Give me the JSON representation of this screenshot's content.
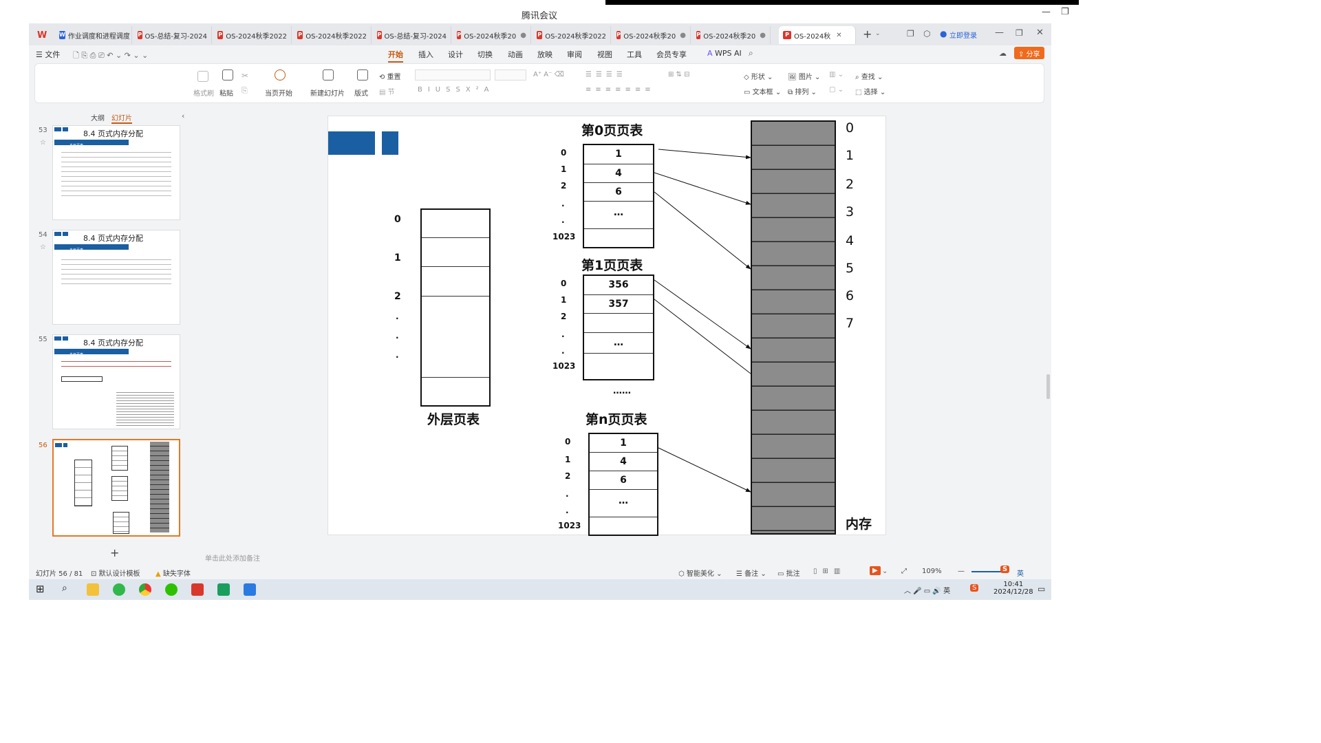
{
  "meeting": {
    "title": "腾讯会议"
  },
  "tabs": [
    {
      "label": "W",
      "type": "wps"
    },
    {
      "label": "作业调度和进程调度",
      "type": "doc"
    },
    {
      "label": "OS-总结-复习-2024",
      "type": "ppt"
    },
    {
      "label": "OS-2024秋季2022",
      "type": "ppt"
    },
    {
      "label": "OS-2024秋季2022",
      "type": "ppt"
    },
    {
      "label": "OS-总结-复习-2024",
      "type": "ppt"
    },
    {
      "label": "OS-2024秋季20",
      "type": "ppt"
    },
    {
      "label": "OS-2024秋季2022",
      "type": "ppt"
    },
    {
      "label": "OS-2024秋季20",
      "type": "ppt"
    },
    {
      "label": "OS-2024秋季20",
      "type": "ppt"
    },
    {
      "label": "OS-2024秋",
      "type": "ppt"
    }
  ],
  "account": {
    "login_label": "立即登录"
  },
  "menu": {
    "file": "文件",
    "items": [
      "开始",
      "插入",
      "设计",
      "切换",
      "动画",
      "放映",
      "审阅",
      "视图",
      "工具",
      "会员专享"
    ],
    "active": "开始",
    "wps_ai": "WPS AI",
    "share": "分享"
  },
  "ribbon": {
    "format_painter": "格式刷",
    "paste": "粘贴",
    "from_current": "当页开始",
    "new_slide": "新建幻灯片",
    "layout": "版式",
    "reset": "重置",
    "section": "节",
    "shape": "形状",
    "picture": "图片",
    "textbox": "文本框",
    "arrange": "排列",
    "find": "查找",
    "select": "选择"
  },
  "left_pane": {
    "tab_outline": "大纲",
    "tab_slides": "幻灯片",
    "thumbnails": [
      {
        "num": "53",
        "title": "8.4 页式内存分配",
        "sub": "多级页表"
      },
      {
        "num": "54",
        "title": "8.4 页式内存分配",
        "sub": "多级页表"
      },
      {
        "num": "55",
        "title": "8.4 页式内存分配",
        "sub": "多级页表"
      },
      {
        "num": "56",
        "title": "",
        "sub": ""
      }
    ],
    "add": "+"
  },
  "slide": {
    "outer_indices": [
      "0",
      "1",
      "2",
      ".",
      ".",
      "."
    ],
    "outer_label": "外层页表",
    "page_tables": [
      {
        "title": "第0页页表",
        "indices": [
          "0",
          "1",
          "2",
          ".",
          ".",
          "1023"
        ],
        "entries": [
          "1",
          "4",
          "6",
          "…",
          ""
        ]
      },
      {
        "title": "第1页页表",
        "indices": [
          "0",
          "1",
          "2",
          ".",
          ".",
          "1023"
        ],
        "entries": [
          "356",
          "357",
          "",
          "…",
          ""
        ]
      },
      {
        "title": "第n页页表",
        "indices": [
          "0",
          "1",
          "2",
          ".",
          ".",
          "1023"
        ],
        "entries": [
          "1",
          "4",
          "6",
          "…",
          ""
        ]
      }
    ],
    "dots_between": "……",
    "memory_indices": [
      "0",
      "1",
      "2",
      "3",
      "4",
      "5",
      "6",
      "7"
    ],
    "memory_label": "内存",
    "colors": {
      "accent": "#1b5fa3",
      "memory_fill": "#8c8c8c"
    }
  },
  "notes_placeholder": "单击此处添加备注",
  "status": {
    "slide_count": "幻灯片 56 / 81",
    "template": "默认设计模板",
    "missing_font": "缺失字体",
    "beautify": "智能美化",
    "notes": "备注",
    "comments": "批注",
    "zoom": "109%"
  },
  "taskbar": {
    "time": "10:41",
    "date": "2024/12/28",
    "ime": "英"
  }
}
